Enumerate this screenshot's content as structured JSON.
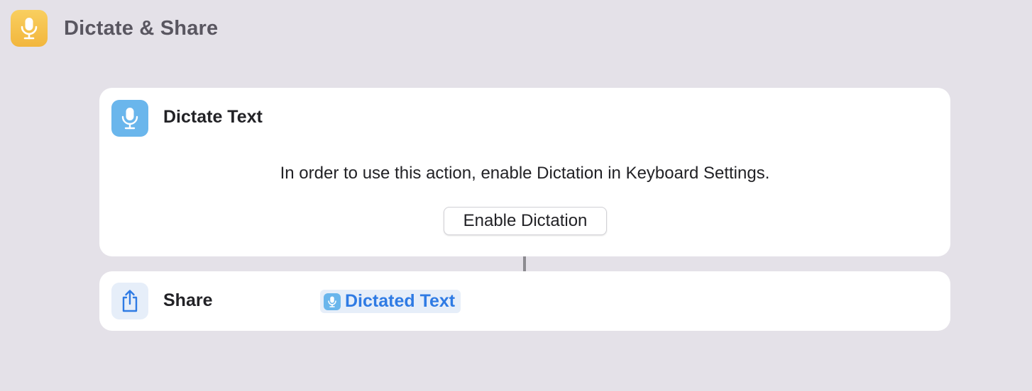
{
  "header": {
    "title": "Dictate & Share",
    "icon": "microphone-icon",
    "icon_color": "#f5c04a"
  },
  "actions": [
    {
      "title": "Dictate Text",
      "icon": "microphone-icon",
      "icon_color": "#6ab6ec",
      "message": "In order to use this action, enable Dictation in Keyboard Settings.",
      "button_label": "Enable Dictation"
    },
    {
      "title": "Share",
      "icon": "share-icon",
      "icon_color": "#2f7be4",
      "variable": {
        "label": "Dictated Text",
        "icon": "microphone-icon",
        "color": "#2f7be4"
      }
    }
  ]
}
